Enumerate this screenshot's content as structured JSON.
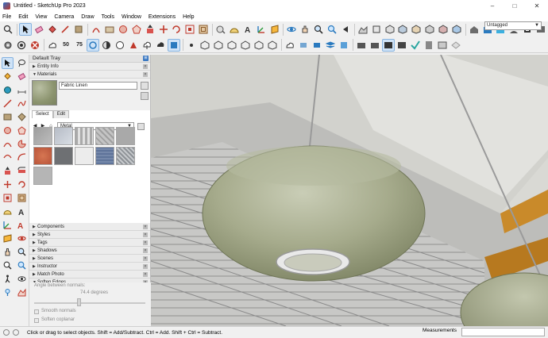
{
  "window": {
    "title": "Untitled - SketchUp Pro 2023",
    "controls": [
      "–",
      "□",
      "✕"
    ]
  },
  "menu": [
    "File",
    "Edit",
    "View",
    "Camera",
    "Draw",
    "Tools",
    "Window",
    "Extensions",
    "Help"
  ],
  "toolbar1": {
    "icons": [
      "search-icon",
      "select-icon",
      "eraser-icon",
      "paint-bucket-icon",
      "line-icon",
      "pencil-icon",
      "arc-icon",
      "rectangle-icon",
      "circle-icon",
      "polygon-icon",
      "push-pull-icon",
      "move-icon",
      "rotate-icon",
      "scale-icon",
      "offset-icon",
      "follow-me-icon",
      "tape-measure-icon",
      "protractor-icon",
      "text-icon",
      "axes-icon",
      "dimension-icon",
      "section-plane-icon",
      "orbit-icon",
      "pan-icon",
      "zoom-icon",
      "zoom-extents-icon",
      "previous-view-icon",
      "walk-icon",
      "look-around-icon",
      "position-camera-icon",
      "sandbox-icon",
      "solid-tools-icon",
      "outer-shell-icon",
      "intersect-icon",
      "union-icon",
      "subtract-icon",
      "trim-icon",
      "split-icon",
      "warehouse-icon",
      "extension-warehouse-icon",
      "layout-icon",
      "user-icon",
      "model-info-icon",
      "tags-icon",
      "camera-icon"
    ],
    "tag_select": "Untagged"
  },
  "toolbar2": {
    "badges": [
      "50",
      "75"
    ],
    "icons": [
      "sun-icon",
      "shadow-icon",
      "fog-icon",
      "xray-icon",
      "back-edges-icon",
      "wireframe-icon",
      "hidden-line-icon",
      "shaded-icon",
      "textured-icon",
      "monochrome-icon",
      "cloud-icon",
      "cloud-download-icon",
      "cloud-upload-icon",
      "component-icon",
      "iso-view-icon",
      "top-view-icon",
      "front-view-icon",
      "right-view-icon",
      "back-view-icon",
      "left-view-icon",
      "bottom-view-icon",
      "section-display-icon",
      "section-cut-icon",
      "section-fill-icon",
      "layers-icon",
      "style-icon",
      "check-icon",
      "walkthrough-icon",
      "model-icon"
    ]
  },
  "tray": {
    "title": "Default Tray",
    "sections": [
      "Entity Info",
      "Materials",
      "Components",
      "Styles",
      "Tags",
      "Shadows",
      "Scenes",
      "Instructor",
      "Match Photo",
      "Soften Edges"
    ],
    "material_name": "Fabric Linen",
    "tabs": [
      "Select",
      "Edit"
    ],
    "library": "Metal",
    "swatch_colors": [
      "#a8a8a8",
      "#c3c7ce",
      "#cfcfcf",
      "#b0b0b0",
      "#a6a6a6",
      "#c96b4c",
      "#6f7174",
      "#ececec",
      "#6c7f9e",
      "#a0a4aa",
      "#b4b4b4"
    ],
    "soften": {
      "label": "Angle between normals:",
      "angle": "74.4  degrees",
      "smooth": "Smooth normals",
      "coplanar": "Soften coplanar"
    }
  },
  "lefttools": [
    "select-icon",
    "lasso-icon",
    "paint-bucket-icon",
    "eraser-icon",
    "tape-measure-icon",
    "dimension-icon",
    "line-icon",
    "freehand-icon",
    "rectangle-icon",
    "rotated-rectangle-icon",
    "circle-icon",
    "polygon-icon",
    "arc-icon",
    "pie-icon",
    "3point-arc-icon",
    "2point-arc-icon",
    "push-pull-icon",
    "follow-me-icon",
    "move-icon",
    "rotate-icon",
    "scale-icon",
    "offset-icon",
    "protractor-icon",
    "text-icon",
    "axes-icon",
    "3d-text-icon",
    "section-plane-icon",
    "orbit-icon",
    "pan-icon",
    "zoom-icon",
    "zoom-window-icon",
    "zoom-extents-icon",
    "walk-icon",
    "look-around-icon",
    "position-camera-icon",
    "sandbox-icon"
  ],
  "status": {
    "message": "Click or drag to select objects. Shift = Add/Subtract. Ctrl = Add. Shift + Ctrl = Subtract.",
    "measurements_label": "Measurements",
    "measurements_value": ""
  }
}
